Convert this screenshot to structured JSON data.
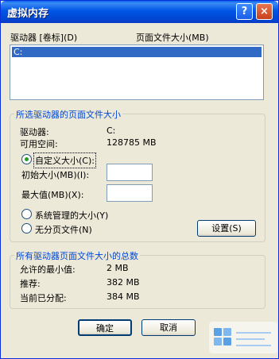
{
  "window": {
    "title": "虚拟内存",
    "help_glyph": "?",
    "close_glyph": "×"
  },
  "drives": {
    "col_drive": "驱动器 [卷标](D)",
    "col_pagesize": "页面文件大小(MB)",
    "items": [
      {
        "label": "C:",
        "selected": true
      }
    ]
  },
  "selected_drive": {
    "group_title": "所选驱动器的页面文件大小",
    "drive_label": "驱动器:",
    "drive_value": "C:",
    "space_label": "可用空间:",
    "space_value": "128785 MB",
    "custom_label": "自定义大小(C):",
    "initial_label": "初始大小(MB)(I):",
    "max_label": "最大值(MB)(X):",
    "system_label": "系统管理的大小(Y)",
    "nopaging_label": "无分页文件(N)",
    "set_button": "设置(S)",
    "selected_option": "custom"
  },
  "totals": {
    "group_title": "所有驱动器页面文件大小的总数",
    "min_label": "允许的最小值:",
    "min_value": "2 MB",
    "recommended_label": "推荐:",
    "recommended_value": "382 MB",
    "current_label": "当前已分配:",
    "current_value": "384 MB"
  },
  "footer": {
    "ok_button": "确定",
    "cancel_button": "取消"
  }
}
